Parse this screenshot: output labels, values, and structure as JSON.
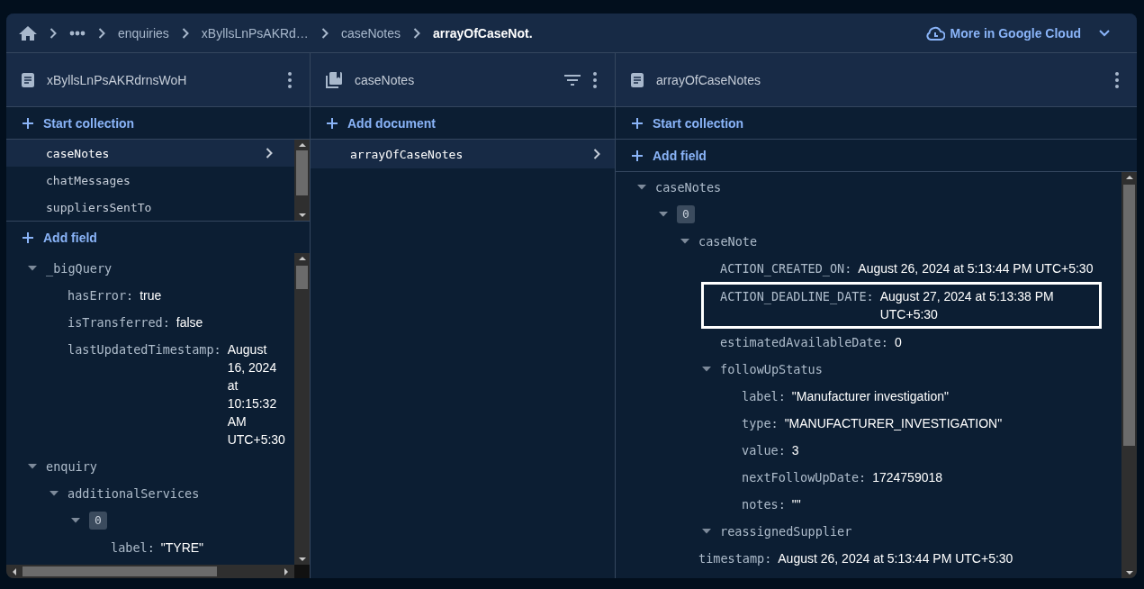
{
  "breadcrumbs": [
    {
      "label": "enquiries",
      "selected": false
    },
    {
      "label": "xByllsLnPsAKRd…",
      "selected": false
    },
    {
      "label": "caseNotes",
      "selected": false
    },
    {
      "label": "arrayOfCaseNot.",
      "selected": true
    }
  ],
  "cloud_link": "More in Google Cloud",
  "document_panel": {
    "title": "xByllsLnPsAKRdrnsWoH",
    "start_collection": "Start collection",
    "subcollections": [
      {
        "name": "caseNotes",
        "selected": true
      },
      {
        "name": "chatMessages",
        "selected": false
      },
      {
        "name": "suppliersSentTo",
        "selected": false
      }
    ],
    "add_field": "Add field",
    "fields": [
      {
        "kind": "map",
        "key": "_bigQuery",
        "expanded": true,
        "children": [
          {
            "kind": "field",
            "key": "hasError:",
            "value": "true"
          },
          {
            "kind": "field",
            "key": "isTransferred:",
            "value": "false"
          },
          {
            "kind": "field",
            "key": "lastUpdatedTimestamp:",
            "value": "August 16, 2024 at 10:15:32 AM UTC+5:30"
          }
        ]
      },
      {
        "kind": "map",
        "key": "enquiry",
        "expanded": true,
        "children": [
          {
            "kind": "map",
            "key": "additionalServices",
            "expanded": true,
            "children": [
              {
                "kind": "index",
                "key": "0",
                "expanded": true,
                "children": [
                  {
                    "kind": "field",
                    "key": "label:",
                    "value": "\"TYRE\""
                  }
                ]
              }
            ]
          }
        ]
      }
    ]
  },
  "collection_panel": {
    "title": "caseNotes",
    "add_document": "Add document",
    "documents": [
      {
        "name": "arrayOfCaseNotes",
        "selected": true
      }
    ]
  },
  "detail_panel": {
    "title": "arrayOfCaseNotes",
    "start_collection": "Start collection",
    "add_field": "Add field",
    "fields": [
      {
        "kind": "map",
        "key": "caseNotes",
        "expanded": true,
        "children": [
          {
            "kind": "index",
            "key": "0",
            "expanded": true,
            "children": [
              {
                "kind": "map",
                "key": "caseNote",
                "expanded": true,
                "children": [
                  {
                    "kind": "field",
                    "key": "ACTION_CREATED_ON:",
                    "value": "August 26, 2024 at 5:13:44 PM UTC+5:30",
                    "highlighted": false
                  },
                  {
                    "kind": "field",
                    "key": "ACTION_DEADLINE_DATE:",
                    "value": "August 27, 2024 at 5:13:38 PM UTC+5:30",
                    "highlighted": true
                  },
                  {
                    "kind": "field",
                    "key": "estimatedAvailableDate:",
                    "value": "0",
                    "highlighted": false
                  },
                  {
                    "kind": "map",
                    "key": "followUpStatus",
                    "expanded": true,
                    "children": [
                      {
                        "kind": "field",
                        "key": "label:",
                        "value": "\"Manufacturer investigation\"",
                        "highlighted": false
                      },
                      {
                        "kind": "field",
                        "key": "type:",
                        "value": "\"MANUFACTURER_INVESTIGATION\"",
                        "highlighted": false
                      },
                      {
                        "kind": "field",
                        "key": "value:",
                        "value": "3",
                        "highlighted": false
                      },
                      {
                        "kind": "field",
                        "key": "nextFollowUpDate:",
                        "value": "1724759018",
                        "highlighted": false
                      },
                      {
                        "kind": "field",
                        "key": "notes:",
                        "value": "\"\"",
                        "highlighted": false
                      }
                    ]
                  },
                  {
                    "kind": "map",
                    "key": "reassignedSupplier",
                    "expanded": true
                  }
                ]
              },
              {
                "kind": "field",
                "key": "timestamp:",
                "value": "August 26, 2024 at 5:13:44 PM UTC+5:30",
                "highlighted": false
              }
            ]
          }
        ]
      }
    ]
  }
}
